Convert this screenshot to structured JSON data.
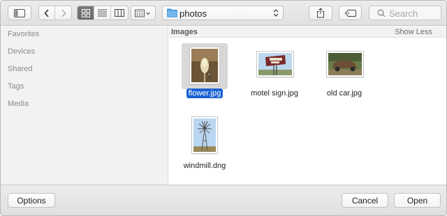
{
  "toolbar": {
    "path": {
      "label": "photos",
      "folder_icon": "folder-icon",
      "folder_color": "#5aa9e6"
    },
    "search": {
      "placeholder": "Search",
      "value": ""
    },
    "view_mode": "icon"
  },
  "sidebar": {
    "items": [
      {
        "label": "Favorites"
      },
      {
        "label": "Devices"
      },
      {
        "label": "Shared"
      },
      {
        "label": "Tags"
      },
      {
        "label": "Media"
      }
    ]
  },
  "main": {
    "section": {
      "title": "Images",
      "toggle_label": "Show Less"
    },
    "files": [
      {
        "name": "flower.jpg",
        "selected": true
      },
      {
        "name": "motel sign.jpg",
        "selected": false
      },
      {
        "name": "old car.jpg",
        "selected": false
      },
      {
        "name": "windmill.dng",
        "selected": false
      }
    ]
  },
  "bottom": {
    "options_label": "Options",
    "cancel_label": "Cancel",
    "open_label": "Open"
  },
  "colors": {
    "selection": "#1a62d3"
  }
}
